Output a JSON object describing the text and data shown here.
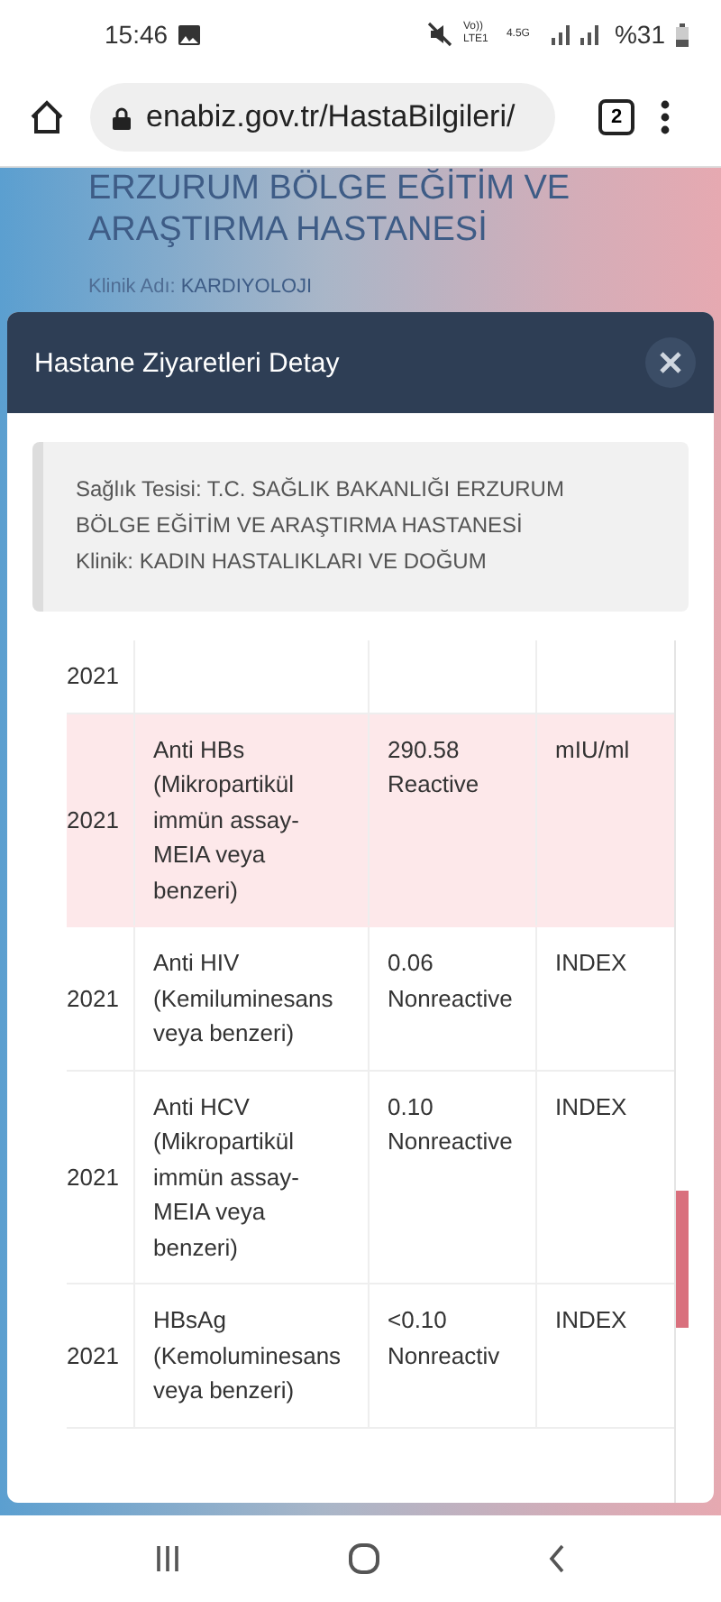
{
  "status_bar": {
    "time": "15:46",
    "network_label": "Vo)) LTE1",
    "network_type": "4.5G",
    "battery": "%31"
  },
  "browser": {
    "url": "enabiz.gov.tr/HastaBilgileri/",
    "tab_count": "2"
  },
  "page": {
    "hospital_title": [
      "ERZURUM BÖLGE EĞİTİM VE",
      "ARAŞTIRMA HASTANESİ"
    ],
    "clinic_label": "Klinik Adı:",
    "clinic_value": "KARDIYOLOJI"
  },
  "modal": {
    "title": "Hastane Ziyaretleri Detay",
    "info_lines": [
      "Sağlık Tesisi: T.C. SAĞLIK BAKANLIĞI ERZURUM",
      "BÖLGE EĞİTİM VE ARAŞTIRMA HASTANESİ",
      "Klinik: KADIN HASTALIKLARI VE DOĞUM"
    ],
    "rows": [
      {
        "date": "2021",
        "test": "",
        "result": "",
        "unit": "",
        "highlighted": false
      },
      {
        "date": "2021",
        "test": "Anti HBs (Mikropartikül immün assay-MEIA veya benzeri)",
        "result": "290.58 Reactive",
        "unit": "mIU/ml",
        "highlighted": true
      },
      {
        "date": "2021",
        "test": "Anti HIV (Kemiluminesans veya benzeri)",
        "result": "0.06 Nonreactive",
        "unit": "INDEX",
        "highlighted": false
      },
      {
        "date": "2021",
        "test": "Anti HCV (Mikropartikül immün assay-MEIA veya benzeri)",
        "result": "0.10 Nonreactive",
        "unit": "INDEX",
        "highlighted": false
      },
      {
        "date": "2021",
        "test": "HBsAg (Kemoluminesans veya benzeri)",
        "result": "<0.10 Nonreactiv",
        "unit": "INDEX",
        "highlighted": false
      }
    ]
  }
}
